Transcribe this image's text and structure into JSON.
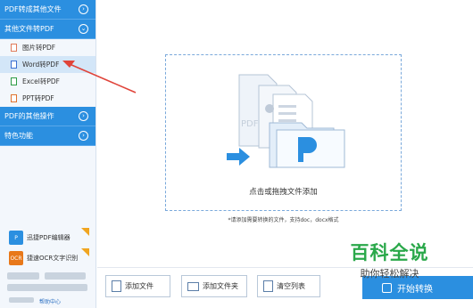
{
  "sidebar": {
    "sections": [
      {
        "label": "PDF转成其他文件",
        "chevron": "⊙"
      },
      {
        "label": "其他文件转PDF",
        "chevron": "⊙"
      },
      {
        "label": "PDF的其他操作",
        "chevron": "⊙"
      },
      {
        "label": "特色功能",
        "chevron": "⊙"
      }
    ],
    "items": [
      {
        "label": "图片转PDF",
        "icon": "image-file-icon"
      },
      {
        "label": "Word转PDF",
        "icon": "word-file-icon"
      },
      {
        "label": "Excel转PDF",
        "icon": "excel-file-icon"
      },
      {
        "label": "PPT转PDF",
        "icon": "ppt-file-icon"
      }
    ],
    "promos": [
      {
        "label": "迅捷PDF编辑器",
        "badge": "P",
        "color": "#2b8fe0"
      },
      {
        "label": "捷速OCR文字识别",
        "badge": "OCR",
        "color": "#e8781a"
      }
    ],
    "footer_links": [
      "帮助中心"
    ]
  },
  "main": {
    "drop_text": "点击或拖拽文件添加",
    "hint": "*请添加需要转换的文件，支持doc，docx格式"
  },
  "toolbar": {
    "add_file": "添加文件",
    "add_folder": "添加文件夹",
    "clear_list": "清空列表",
    "start": "开始转换"
  },
  "watermark": {
    "line1": "百科全说",
    "line2": "助你轻松解决"
  },
  "colors": {
    "accent": "#2b8fe0",
    "arrow": "#e0443a",
    "watermark": "#2aa84a"
  }
}
